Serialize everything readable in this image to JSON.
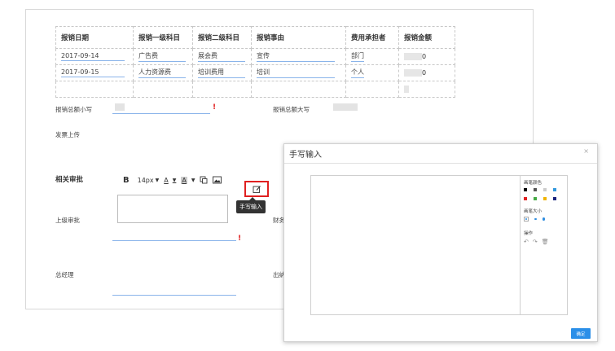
{
  "table": {
    "headers": [
      "报销日期",
      "报销一级科目",
      "报销二级科目",
      "报销事由",
      "费用承担者",
      "报销金额"
    ],
    "rows": [
      [
        "2017-09-14",
        "广告费",
        "展会费",
        "宣传",
        "部门",
        "0"
      ],
      [
        "2017-09-15",
        "人力资源费",
        "培训费用",
        "培训",
        "个人",
        "0"
      ]
    ]
  },
  "form": {
    "total_small_label": "报销总额小写",
    "total_big_label": "报销总额大写",
    "invoice_label": "发票上传",
    "approval_title": "相关审批",
    "superior_label": "上级审批",
    "finance_label": "财务",
    "gm_label": "总经理",
    "cashier_label": "出纳",
    "required_mark": "!"
  },
  "toolbar": {
    "bold": "B",
    "font_size": "14px",
    "font_color": "A",
    "bg_color": "A",
    "tooltip": "手写输入"
  },
  "modal": {
    "title": "手写输入",
    "close": "×",
    "pen_color_label": "画笔颜色",
    "pen_size_label": "画笔大小",
    "ops_label": "操作",
    "confirm": "确定",
    "colors": [
      "#000000",
      "#555555",
      "#cccccc",
      "#3399dd",
      "#e02020",
      "#44aa44",
      "#f0b400",
      "#1a237e"
    ]
  },
  "accent_color": "#2b8fe8",
  "required_color": "#e02020"
}
